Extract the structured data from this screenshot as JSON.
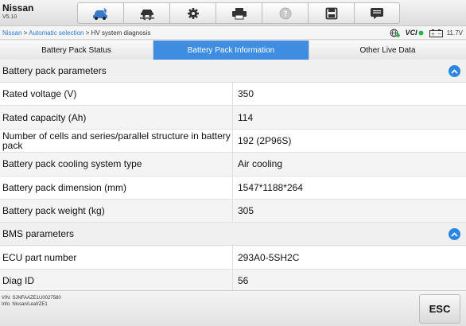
{
  "app": {
    "title": "Nissan",
    "version": "V5.10"
  },
  "toolbar": {
    "buttons": [
      {
        "icon": "car-home-icon"
      },
      {
        "icon": "vehicle-lift-icon"
      },
      {
        "icon": "gear-icon"
      },
      {
        "icon": "printer-icon"
      },
      {
        "icon": "help-icon"
      },
      {
        "icon": "save-icon"
      },
      {
        "icon": "message-icon"
      }
    ]
  },
  "breadcrumb": {
    "items": [
      "Nissan",
      " > ",
      "Automatic selection",
      " > HV system diagnosis"
    ]
  },
  "status": {
    "vci": "VCI",
    "voltage": "11.7V"
  },
  "tabs": [
    {
      "label": "Battery Pack Status",
      "active": false
    },
    {
      "label": "Battery Pack Information",
      "active": true
    },
    {
      "label": "Other Live Data",
      "active": false
    }
  ],
  "sections": [
    {
      "title": "Battery pack parameters",
      "rows": [
        {
          "label": "Rated voltage (V)",
          "value": "350"
        },
        {
          "label": "Rated capacity (Ah)",
          "value": "114"
        },
        {
          "label": "Number of cells and series/parallel structure in battery pack",
          "value": "192 (2P96S)"
        },
        {
          "label": "Battery pack cooling system type",
          "value": "Air cooling"
        },
        {
          "label": "Battery pack dimension (mm)",
          "value": "1547*1188*264"
        },
        {
          "label": "Battery pack weight (kg)",
          "value": "305"
        }
      ]
    },
    {
      "title": "BMS parameters",
      "rows": [
        {
          "label": "ECU part number",
          "value": "293A0-5SH2C"
        },
        {
          "label": "Diag ID",
          "value": "56"
        }
      ]
    }
  ],
  "footer": {
    "vin": "VIN: SJNFAAZE1U0027580",
    "info": "Info: Nissan/Leaf/ZE1",
    "esc_label": "ESC"
  },
  "colors": {
    "accent": "#3e8de0",
    "link": "#2b7bd6"
  }
}
